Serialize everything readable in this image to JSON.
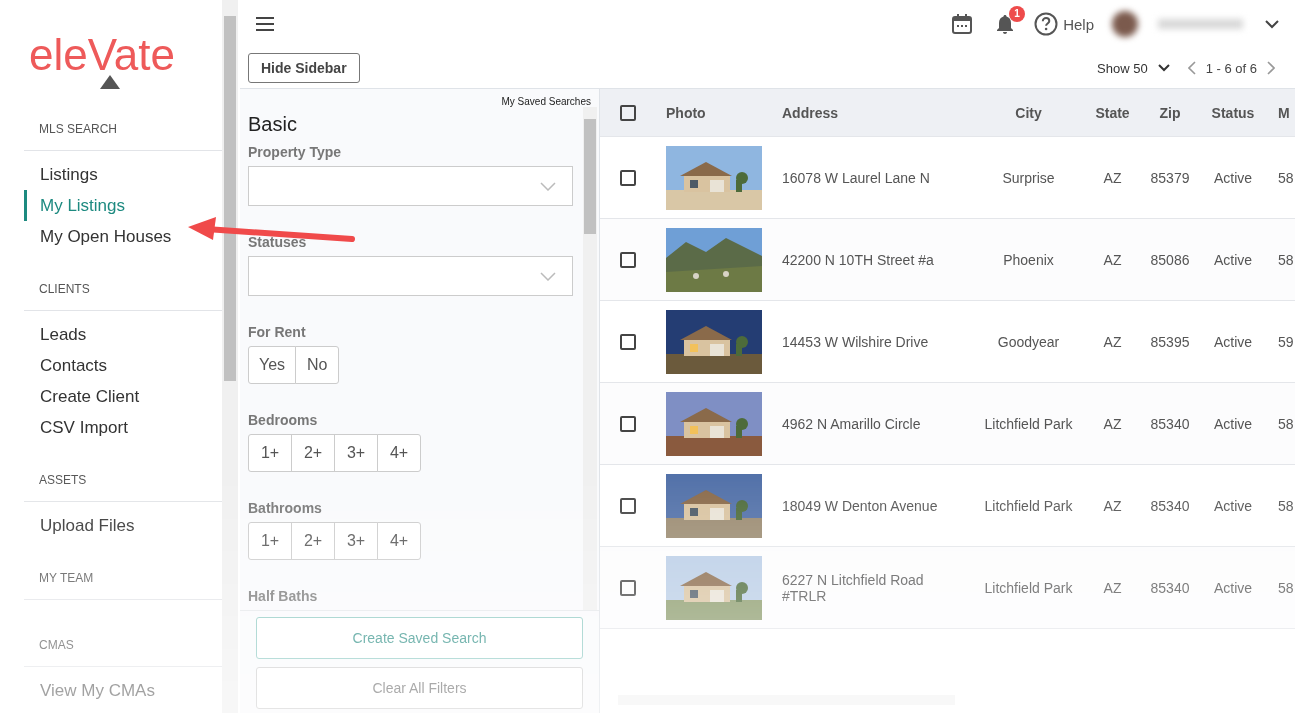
{
  "logo": {
    "text": "eleVate"
  },
  "sidebar": {
    "sections": [
      {
        "heading": "MLS SEARCH",
        "items": [
          {
            "label": "Listings",
            "selected": false
          },
          {
            "label": "My Listings",
            "selected": true
          },
          {
            "label": "My Open Houses",
            "selected": false
          }
        ]
      },
      {
        "heading": "CLIENTS",
        "items": [
          {
            "label": "Leads",
            "selected": false
          },
          {
            "label": "Contacts",
            "selected": false
          },
          {
            "label": "Create Client",
            "selected": false
          },
          {
            "label": "CSV Import",
            "selected": false
          }
        ]
      },
      {
        "heading": "ASSETS",
        "items": [
          {
            "label": "Upload Files",
            "selected": false
          }
        ]
      },
      {
        "heading": "MY TEAM"
      },
      {
        "heading": "CMAS",
        "items": [
          {
            "label": "View My CMAs",
            "selected": false
          }
        ]
      }
    ]
  },
  "header": {
    "notification_count": "1",
    "help": "Help"
  },
  "toolbar": {
    "hide_sidebar": "Hide Sidebar",
    "page_size": "Show 50",
    "range": "1 - 6 of 6"
  },
  "filters": {
    "saved_searches": "My Saved Searches",
    "title": "Basic",
    "fields": [
      {
        "kind": "select",
        "label": "Property Type"
      },
      {
        "kind": "select",
        "label": "Statuses"
      },
      {
        "kind": "toggle",
        "label": "For Rent",
        "options": [
          {
            "label": "Yes",
            "selected": false
          },
          {
            "label": "No",
            "selected": false
          }
        ]
      },
      {
        "kind": "toggle",
        "label": "Bedrooms",
        "options": [
          {
            "label": "1+",
            "selected": false
          },
          {
            "label": "2+",
            "selected": false
          },
          {
            "label": "3+",
            "selected": false
          },
          {
            "label": "4+",
            "selected": false
          }
        ]
      },
      {
        "kind": "toggle",
        "label": "Bathrooms",
        "options": [
          {
            "label": "1+",
            "selected": false
          },
          {
            "label": "2+",
            "selected": false
          },
          {
            "label": "3+",
            "selected": false
          },
          {
            "label": "4+",
            "selected": false
          }
        ]
      },
      {
        "kind": "heading",
        "label": "Half Baths"
      }
    ],
    "buttons": [
      "Create Saved Search",
      "Clear All Filters"
    ]
  },
  "table": {
    "columns": [
      "Photo",
      "Address",
      "City",
      "State",
      "Zip",
      "Status",
      "M"
    ],
    "header_checked": false,
    "rows": [
      {
        "checked": false,
        "address": "16078 W Laurel Lane N",
        "city": "Surprise",
        "state": "AZ",
        "zip": "85379",
        "status": "Active",
        "column_8": "58"
      },
      {
        "checked": false,
        "address": "42200 N 10TH Street #a",
        "city": "Phoenix",
        "state": "AZ",
        "zip": "85086",
        "status": "Active",
        "column_8": "58"
      },
      {
        "checked": false,
        "address": "14453 W Wilshire Drive",
        "city": "Goodyear",
        "state": "AZ",
        "zip": "85395",
        "status": "Active",
        "column_8": "59"
      },
      {
        "checked": false,
        "address": "4962 N Amarillo Circle",
        "city": "Litchfield Park",
        "state": "AZ",
        "zip": "85340",
        "status": "Active",
        "column_8": "58"
      },
      {
        "checked": false,
        "address": "18049 W Denton Avenue",
        "city": "Litchfield Park",
        "state": "AZ",
        "zip": "85340",
        "status": "Active",
        "column_8": "58"
      },
      {
        "checked": false,
        "address": "6227 N Litchfield Road #TRLR",
        "city": "Litchfield Park",
        "state": "AZ",
        "zip": "85340",
        "status": "Active",
        "column_8": "58"
      }
    ]
  }
}
